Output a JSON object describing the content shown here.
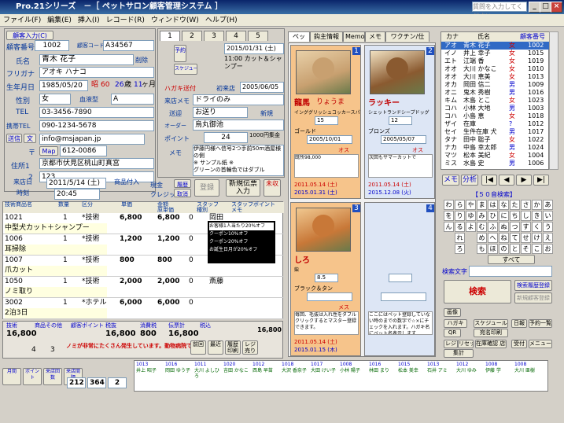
{
  "window": {
    "title": "Pro.21シリーズ　－［ ペットサロン顧客管理システム ］",
    "help_placeholder": "質問を入力してください"
  },
  "menu": [
    "ファイル(F)",
    "編集(E)",
    "挿入(I)",
    "レコード(R)",
    "ウィンドウ(W)",
    "ヘルプ(H)"
  ],
  "customer": {
    "section_label": "顧客入力(C)",
    "no_label": "顧客番号",
    "no": "1002",
    "code_label": "顧客コード",
    "code": "A34567",
    "name_label": "氏名",
    "name": "青木 花子",
    "delete_label": "削除",
    "kana_label": "フリガナ",
    "kana": "アオキ ハナコ",
    "dob_label": "生年月日",
    "dob": "1985/05/20",
    "era": "昭",
    "era_year": "60",
    "age": "26",
    "age_unit": "歳",
    "months": "11",
    "month_unit": "ヶ月",
    "sex_label": "性別",
    "sex": "女",
    "blood_label": "血液型",
    "blood": "A",
    "tel_label": "TEL",
    "tel": "03-3456-7890",
    "mobile_label": "携帯TEL",
    "mobile": "090-1234-5678",
    "send_label": "送信",
    "body_label": "文",
    "email": "info@msjapan.jp",
    "postal_mark": "〒",
    "postal_button": "Map",
    "postal": "612-0086",
    "address_label": "住所1",
    "address1": "京都市伏見区桃山町真宮",
    "address2_label": "2",
    "address2": "123"
  },
  "reservation": {
    "tabs": [
      "1",
      "2",
      "3",
      "4",
      "5"
    ],
    "yoyaku": "予約",
    "date": "2015/01/31 (土)",
    "course": "11:00 カット＆シャンプー",
    "schedule_label": "スケジュール",
    "first_label": "ハガキ送付",
    "first_visit_label": "初来店",
    "first_visit": "2005/06/05",
    "dm_label": "来店メモ",
    "dm": "ドライのみ",
    "delivery_label": "送迎",
    "delivery": "お送り",
    "new_label": "新規",
    "order_label": "オーダー",
    "order": "烏丸御池",
    "point_label": "ポイント",
    "point": "24",
    "point_value": "1000",
    "point_unit": "円集金",
    "memo_label": "メモ",
    "memo": "伊藤円様へ信号2つ手前50m酒屋様の側\n※ サンプル紙 ※\nグリーンの首輪色ではダブル"
  },
  "visit": {
    "came_label": "来店日",
    "time_label": "時刻",
    "date": "2011/5/14 (土)",
    "time": "20:45",
    "goods_label": "商品付入",
    "cash_label": "現金",
    "credit_label": "クレジット",
    "history_label": "履歴",
    "cancel_label": "取消",
    "register_label": "登録",
    "new_slip_label": "新規伝票入力",
    "unpaid_label": "未収"
  },
  "slip": {
    "headers": [
      "技術商品名",
      "数量",
      "区分",
      "単価",
      "金額\n原単価",
      "スタッフ\n種別",
      "スタッフポイント\nメモ"
    ],
    "rows": [
      {
        "code": "1021",
        "qty": "1",
        "type": "*技術",
        "price": "6,800",
        "amount": "6,800",
        "tax": "0",
        "staff": "岡田",
        "name": "中型犬カット＋シャンプー"
      },
      {
        "code": "1006",
        "qty": "1",
        "type": "*技術",
        "price": "1,200",
        "amount": "1,200",
        "tax": "0",
        "staff": "岡田",
        "name": "耳掃除"
      },
      {
        "code": "1007",
        "qty": "1",
        "type": "*技術",
        "price": "800",
        "amount": "800",
        "tax": "0",
        "staff": "岡田",
        "name": "爪カット"
      },
      {
        "code": "1050",
        "qty": "1",
        "type": "*技術",
        "price": "2,000",
        "amount": "2,000",
        "tax": "0",
        "staff": "斎藤",
        "name": "ノミ取り"
      },
      {
        "code": "3002",
        "qty": "1",
        "type": "*ホテル",
        "price": "6,000",
        "amount": "6,000",
        "tax": "0",
        "staff": "",
        "name": "2泊3日"
      }
    ],
    "coupon_popup": [
      "お客様1人当たり20%オフ",
      "クーポン10%オフ",
      "クーポン20%オフ",
      "お誕生日月が20%オフ"
    ],
    "staff_memo": "ノミが非常に多かった／ヒトリシャンプー勧めた"
  },
  "totals": {
    "labels": [
      "技術",
      "商品その他",
      "顧客ポイント",
      "税抜",
      "消費税",
      "伝票計",
      "税込"
    ],
    "values": [
      "16,800",
      "16,800",
      "800",
      "16,800"
    ],
    "extra": "0",
    "discount_label": "割引",
    "note": "ノミが非常にたくさん発生しています。動物病院での処置を",
    "rank": "4",
    "rank2": "3",
    "buttons": [
      "前回",
      "最近",
      "履歴印刷",
      "レジ売り"
    ],
    "total2": "16,800"
  },
  "bottom_left": {
    "labels": [
      "月間",
      "ポイント",
      "来店回数",
      "来店間隔"
    ],
    "values": [
      "212",
      "364",
      "2"
    ]
  },
  "pet_tabs": [
    "ペット",
    "鈎主情報",
    "Memo",
    "メモ",
    "ワクチン/仕入れ"
  ],
  "pets": [
    {
      "num": "1",
      "name": "龍馬",
      "kana": "りょうま",
      "breed": "インググリッシュコッカースパニエル",
      "weight": "15",
      "color": "ゴールド",
      "dob": "2005/10/01",
      "age": "5",
      "sex": "オス",
      "memo": "既所98,000",
      "visit_date": "2011.05.14 (土)",
      "next_date": "2015.01.31 (土)",
      "accent": "#f6c48b"
    },
    {
      "num": "2",
      "name": "ラッキー",
      "kana": "",
      "breed": "シェットランドシープドッグ",
      "weight": "12",
      "color": "ブロンズ",
      "dob": "2005/05/07",
      "age": "6",
      "sex": "オス",
      "memo": "次回もサマーカットで",
      "visit_date": "2011.05.14 (土)",
      "next_date": "2015.12.08 (火)",
      "accent": "#dde6f5"
    },
    {
      "num": "3",
      "name": "しろ",
      "kana": "",
      "breed": "柴",
      "weight": "8.5",
      "color": "ブラック＆タン",
      "dob": "",
      "age": "",
      "sex": "メス",
      "memo": "毎回、毛抜は入れ性をダブルクリックするとマスター登録できます。",
      "visit_date": "2011.05.14 (土)",
      "next_date": "2015.01.15 (木)",
      "accent": "#f6c48b"
    },
    {
      "num": "4",
      "name": "",
      "kana": "",
      "breed": "",
      "weight": "",
      "color": "",
      "dob": "",
      "age": "",
      "sex": "",
      "memo": "ここにはペット登録していない時のまでの数字で☆×にチェックを入れます。ハガキ名にペット名表示します",
      "visit_date": "",
      "next_date": "",
      "accent": "#dde6f5"
    }
  ],
  "list": {
    "header_kana": "カナ",
    "header_name": "氏名",
    "header_no": "顧客番号",
    "rows": [
      [
        "アオ",
        "青木 花子",
        "女",
        "1002"
      ],
      [
        "イノ",
        "井上 幸子",
        "女",
        "1015"
      ],
      [
        "エト",
        "江端 香",
        "女",
        "1019"
      ],
      [
        "オオ",
        "大川 かなこ",
        "女",
        "1010"
      ],
      [
        "オオ",
        "大川 恵美",
        "女",
        "1013"
      ],
      [
        "オカ",
        "岡田 信二",
        "男",
        "1009"
      ],
      [
        "オニ",
        "鬼木 秀樹",
        "男",
        "1016"
      ],
      [
        "キム",
        "木島 とこ",
        "女",
        "1023"
      ],
      [
        "コハ",
        "小林 大地",
        "男",
        "1003"
      ],
      [
        "コハ",
        "小島 恵",
        "女",
        "1018"
      ],
      [
        "ザイ",
        "在庫",
        "?",
        "1012"
      ],
      [
        "セイ",
        "生件在庫 犬",
        "男",
        "1017"
      ],
      [
        "タナ",
        "田中 聡子",
        "女",
        "1022"
      ],
      [
        "ナカ",
        "中島 幸太郎",
        "男",
        "1024"
      ],
      [
        "マツ",
        "松本 美紀",
        "女",
        "1004"
      ],
      [
        "ミス",
        "水島 史",
        "男",
        "1006"
      ]
    ]
  },
  "right_panel": {
    "btn_memo": "メモ",
    "btn_analysis": "分析",
    "kana_table_title": "【５０音検索】",
    "kana_rows": [
      [
        "わ",
        "ら",
        "や",
        "ま",
        "は",
        "な",
        "た",
        "さ",
        "か",
        "あ"
      ],
      [
        "を",
        "り",
        "ゆ",
        "み",
        "ひ",
        "に",
        "ち",
        "し",
        "き",
        "い"
      ],
      [
        "ん",
        "る",
        "よ",
        "む",
        "ふ",
        "ぬ",
        "つ",
        "す",
        "く",
        "う"
      ],
      [
        "",
        "れ",
        "",
        "め",
        "へ",
        "ね",
        "て",
        "せ",
        "け",
        "え"
      ],
      [
        "",
        "ろ",
        "",
        "も",
        "ほ",
        "の",
        "と",
        "そ",
        "こ",
        "お"
      ]
    ],
    "all_label": "すべて",
    "search_label": "検索文字",
    "search_btn": "検索",
    "search_history": "検索履歴登録",
    "search_new": "新規顧客登録",
    "image": "画像",
    "hagaki": "ハガキ",
    "schedule": "スケジュール",
    "qr": "QR",
    "print": "宛名印刷",
    "daily": "日報",
    "reserve": "予約一覧",
    "cash": "集計",
    "stock": "在庫確認\n店舗履歴",
    "receipt": "受付",
    "menu": "メニュー",
    "register": "レジ",
    "reset": "リセット"
  },
  "staff_schedule": {
    "cols": [
      "1013",
      "1016",
      "1011",
      "1020",
      "1012",
      "1018",
      "1017",
      "1008",
      "1016",
      "1015",
      "1013",
      "1012",
      "1008",
      "1008"
    ],
    "names": [
      "井上 昭子",
      "岡田 ゆう子",
      "大川 よしひろ",
      "吉田 かなこ",
      "西島 早苗",
      "大沢 香奈子",
      "大田 けい子",
      "小林 陽子",
      "林田 まり",
      "松本 美幸",
      "石井 アミ",
      "大川 ゆみ",
      "伊藤 学",
      "大川 亜樹"
    ]
  }
}
